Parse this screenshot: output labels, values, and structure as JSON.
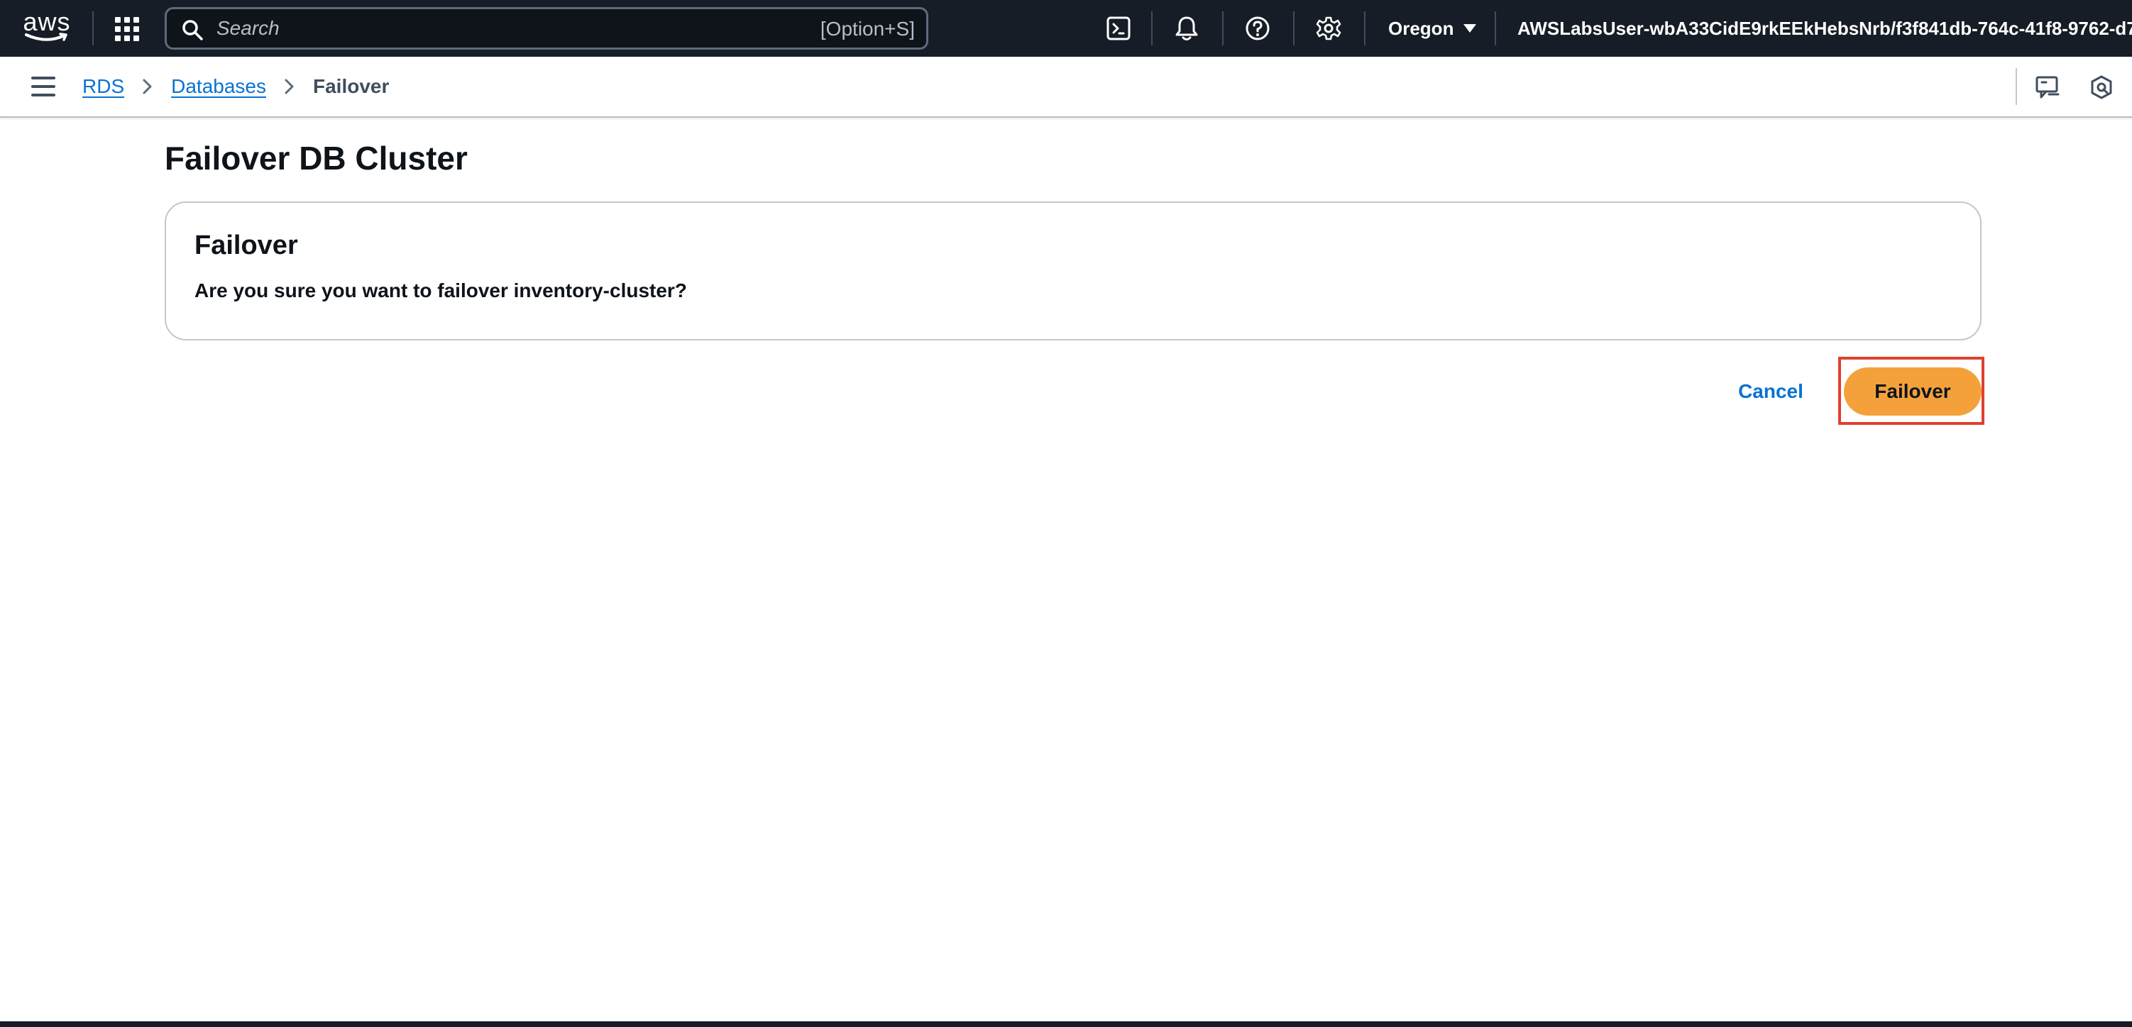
{
  "topbar": {
    "logo_text": "aws",
    "search": {
      "placeholder": "Search",
      "value": "",
      "shortcut": "[Option+S]"
    },
    "icons": [
      "cloudshell-icon",
      "bell-icon",
      "help-icon",
      "gear-icon"
    ],
    "region": "Oregon",
    "account": "AWSLabsUser-wbA33CidE9rkEEkHebsNrb/f3f841db-764c-41f8-9762-d7..."
  },
  "breadcrumb": {
    "items": [
      "RDS",
      "Databases"
    ],
    "current": "Failover"
  },
  "page": {
    "title": "Failover DB Cluster"
  },
  "panel": {
    "title": "Failover",
    "prompt": "Are you sure you want to failover ",
    "cluster_name": "inventory-cluster",
    "prompt_end": "?"
  },
  "actions": {
    "cancel_label": "Cancel",
    "failover_label": "Failover"
  },
  "colors": {
    "topbar_bg": "#161d26",
    "link": "#0972d3",
    "primary_button": "#f4a13c",
    "highlight": "#e0402f"
  }
}
